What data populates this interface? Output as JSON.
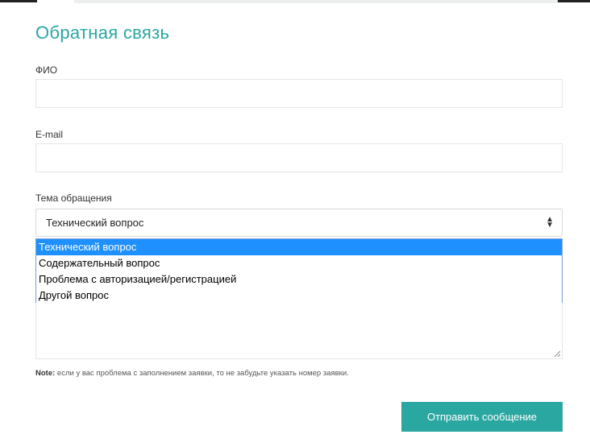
{
  "form": {
    "title": "Обратная связь",
    "fio_label": "ФИО",
    "fio_value": "",
    "email_label": "E-mail",
    "email_value": "",
    "topic_label": "Тема обращения",
    "topic_selected": "Технический вопрос",
    "topic_options": [
      "Технический вопрос",
      "Содержательный вопрос",
      "Проблема с авторизацией/регистрацией",
      "Другой вопрос"
    ],
    "message_value": "",
    "note_prefix": "Note:",
    "note_text": " если у вас проблема с заполнением заявки, то не забудьте указать номер заявки.",
    "submit_label": "Отправить сообщение"
  },
  "colors": {
    "accent": "#2aa7a1",
    "option_highlight": "#1e90ff"
  }
}
